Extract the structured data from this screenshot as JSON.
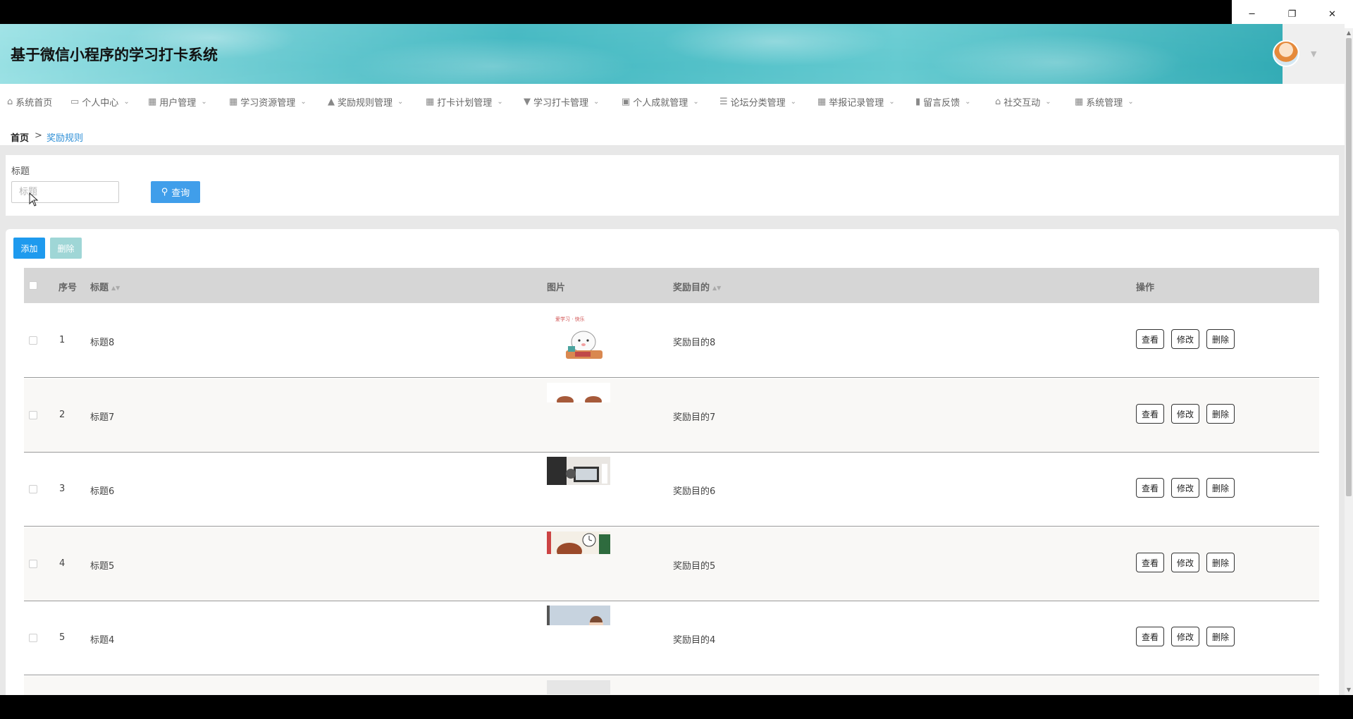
{
  "window": {
    "minimize": "─",
    "restore": "❐",
    "close": "✕"
  },
  "app": {
    "title": "基于微信小程序的学习打卡系统"
  },
  "nav": [
    {
      "label": "系统首页",
      "icon": "home-icon",
      "glyph": "⌂",
      "caret": ""
    },
    {
      "label": "个人中心",
      "icon": "card-icon",
      "glyph": "▭",
      "caret": "⌄"
    },
    {
      "label": "用户管理",
      "icon": "grid-icon",
      "glyph": "▦",
      "caret": "⌄"
    },
    {
      "label": "学习资源管理",
      "icon": "grid-icon",
      "glyph": "▦",
      "caret": "⌄"
    },
    {
      "label": "奖励规则管理",
      "icon": "thumb-up-icon",
      "glyph": "👍",
      "caret": "⌄"
    },
    {
      "label": "打卡计划管理",
      "icon": "grid-icon",
      "glyph": "▦",
      "caret": "⌄"
    },
    {
      "label": "学习打卡管理",
      "icon": "brush-icon",
      "glyph": "▼",
      "caret": "⌄"
    },
    {
      "label": "个人成就管理",
      "icon": "clipboard-icon",
      "glyph": "▣",
      "caret": "⌄"
    },
    {
      "label": "论坛分类管理",
      "icon": "list-icon",
      "glyph": "☰",
      "caret": "⌄"
    },
    {
      "label": "举报记录管理",
      "icon": "grid-icon",
      "glyph": "▦",
      "caret": "⌄"
    },
    {
      "label": "留言反馈",
      "icon": "bar-chart-icon",
      "glyph": "▮",
      "caret": "⌄"
    },
    {
      "label": "社交互动",
      "icon": "bank-icon",
      "glyph": "⌂",
      "caret": "⌄"
    },
    {
      "label": "系统管理",
      "icon": "grid-icon",
      "glyph": "▦",
      "caret": "⌄"
    }
  ],
  "breadcrumb": {
    "home": "首页",
    "sep": ">",
    "current": "奖励规则"
  },
  "search": {
    "label": "标题",
    "placeholder": "标题",
    "value": "",
    "button": "查询"
  },
  "toolbar": {
    "add": "添加",
    "delete": "删除"
  },
  "table": {
    "headers": {
      "index": "序号",
      "title": "标题",
      "image": "图片",
      "purpose": "奖励目的",
      "actions": "操作"
    },
    "rows": [
      {
        "index": "1",
        "title": "标题8",
        "purpose": "奖励目的8"
      },
      {
        "index": "2",
        "title": "标题7",
        "purpose": "奖励目的7"
      },
      {
        "index": "3",
        "title": "标题6",
        "purpose": "奖励目的6"
      },
      {
        "index": "4",
        "title": "标题5",
        "purpose": "奖励目的5"
      },
      {
        "index": "5",
        "title": "标题4",
        "purpose": "奖励目的4"
      }
    ],
    "row_actions": {
      "view": "查看",
      "edit": "修改",
      "delete": "删除"
    }
  },
  "colors": {
    "primary": "#1e9aee",
    "search_button": "#409eea",
    "delete_disabled": "#9fd6d6",
    "header_row": "#d6d6d6"
  }
}
